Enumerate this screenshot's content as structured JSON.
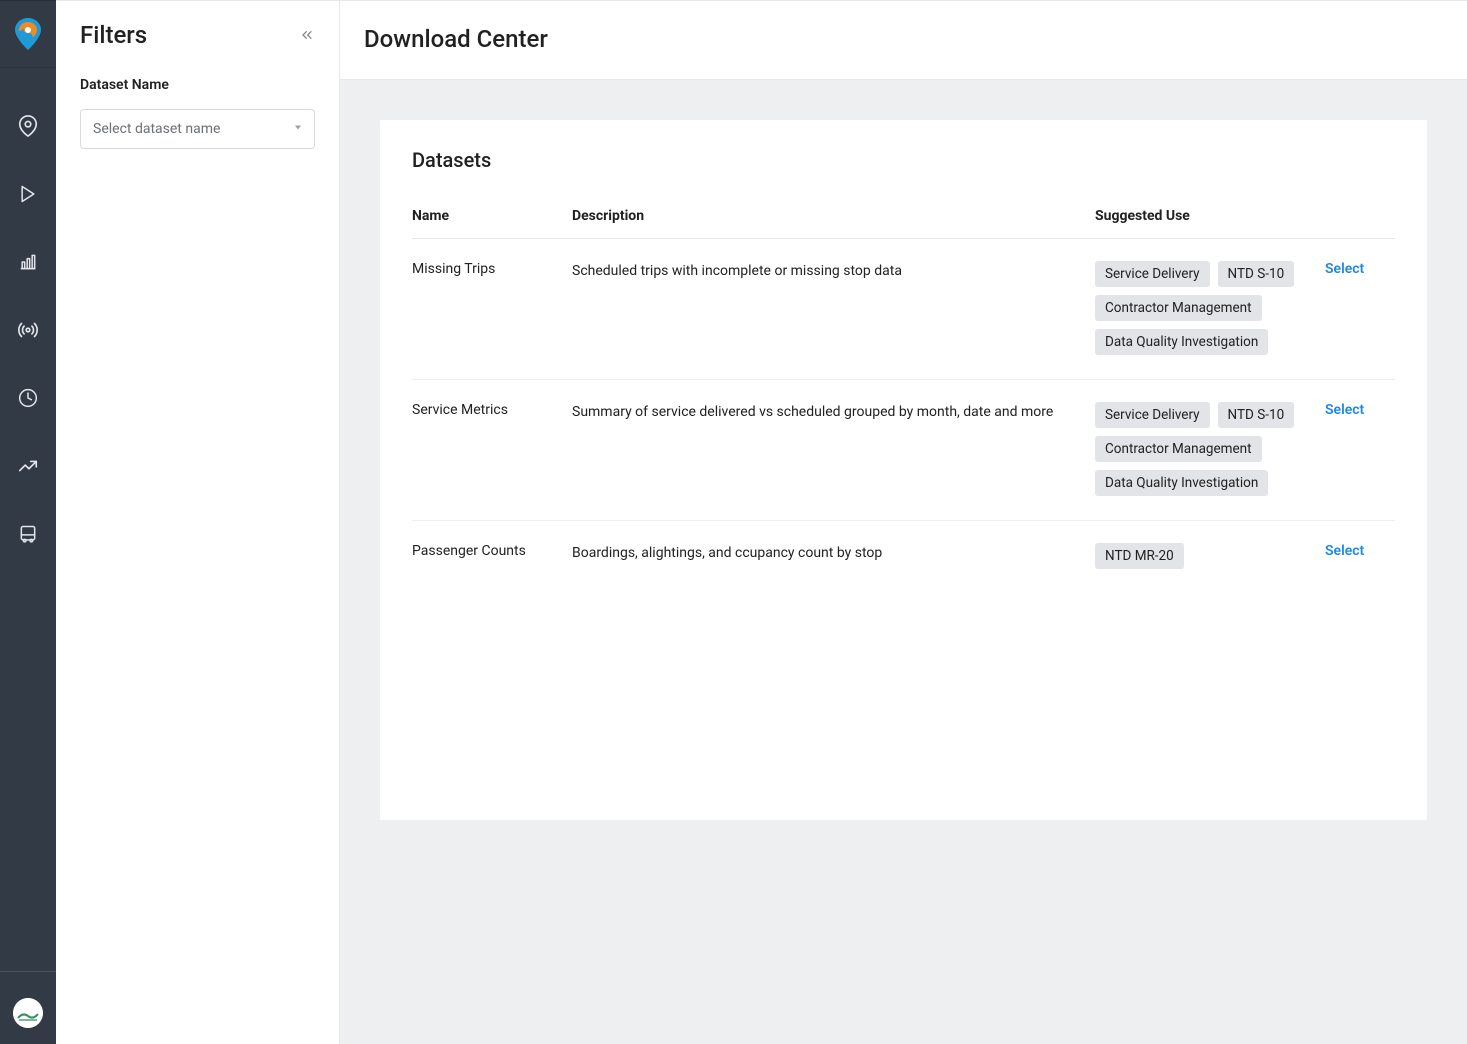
{
  "sidebar": {
    "title": "Filters",
    "dataset_field_label": "Dataset Name",
    "dataset_placeholder": "Select dataset name"
  },
  "header": {
    "page_title": "Download Center"
  },
  "card": {
    "title": "Datasets",
    "columns": {
      "name": "Name",
      "description": "Description",
      "suggested_use": "Suggested Use"
    },
    "select_label": "Select"
  },
  "datasets": [
    {
      "name": "Missing Trips",
      "description": "Scheduled trips with incomplete or missing stop data",
      "tags": [
        "Service Delivery",
        "NTD S-10",
        "Contractor Management",
        "Data Quality Investigation"
      ]
    },
    {
      "name": "Service Metrics",
      "description": "Summary of service delivered vs scheduled grouped by month, date and more",
      "tags": [
        "Service Delivery",
        "NTD S-10",
        "Contractor Management",
        "Data Quality Investigation"
      ]
    },
    {
      "name": "Passenger Counts",
      "description": "Boardings, alightings, and ccupancy count by stop",
      "tags": [
        "NTD MR-20"
      ]
    }
  ],
  "nav_icons": [
    "map-pin-icon",
    "play-icon",
    "bar-chart-icon",
    "broadcast-icon",
    "clock-icon",
    "trending-up-icon",
    "bus-icon"
  ]
}
